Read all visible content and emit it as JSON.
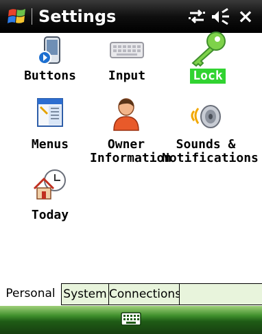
{
  "title_bar": {
    "title": "Settings",
    "close_label": "×",
    "start_icon": "windows-flag-icon",
    "connectivity_icon": "connectivity-arrows-icon",
    "volume_icon": "speaker-volume-icon"
  },
  "items": [
    {
      "label": "Buttons",
      "icon": "buttons-icon"
    },
    {
      "label": "Input",
      "icon": "keyboard-icon"
    },
    {
      "label": "Lock",
      "icon": "key-icon",
      "selected": true
    },
    {
      "label": "Menus",
      "icon": "menus-icon"
    },
    {
      "label_line1": "Owner",
      "label_line2": "Information",
      "icon": "owner-person-icon"
    },
    {
      "label_line1": "Sounds &",
      "label_line2": "Notifications",
      "icon": "sounds-speaker-icon"
    },
    {
      "label": "Today",
      "icon": "today-house-clock-icon"
    }
  ],
  "tabs": [
    {
      "label": "Personal",
      "active": true
    },
    {
      "label": "System",
      "active": false
    },
    {
      "label": "Connections",
      "active": false
    }
  ],
  "softkey_bar": {
    "sip_icon": "keyboard-sip-icon"
  },
  "colors": {
    "selection": "#31d331",
    "tab_inactive": "#e8f4dc",
    "softbar_green": "#3f8f2c"
  }
}
